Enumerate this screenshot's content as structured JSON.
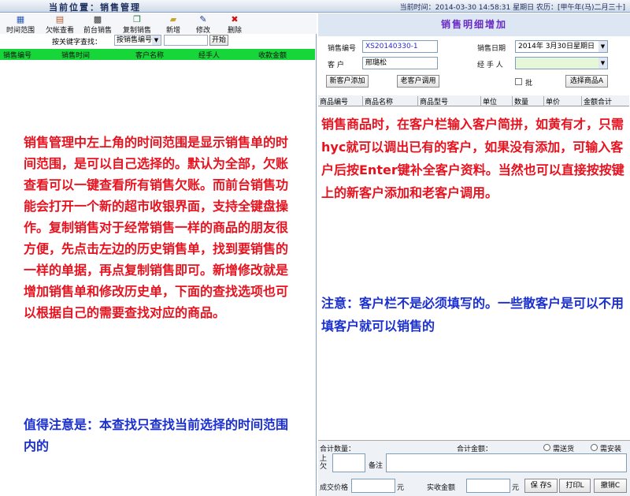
{
  "topbar": {
    "location": "当前位置：销售管理",
    "time": "当前时间：2014-03-30  14:58:31  星期日   农历：[甲午年(马)二月三十]"
  },
  "toolbar": {
    "items": [
      {
        "label": "时间范围",
        "icon": "calendar-icon"
      },
      {
        "label": "欠帐查看",
        "icon": "debt-icon"
      },
      {
        "label": "前台销售",
        "icon": "register-icon"
      },
      {
        "label": "复制销售",
        "icon": "copy-icon"
      },
      {
        "label": "新增",
        "icon": "folder-icon"
      },
      {
        "label": "修改",
        "icon": "edit-icon"
      },
      {
        "label": "删除",
        "icon": "delete-icon"
      }
    ]
  },
  "search": {
    "label": "按关键字查找：",
    "select_value": "按销售编号",
    "start_label": "开始"
  },
  "left_grid": {
    "columns": [
      "销售编号",
      "销售时间",
      "客户名称",
      "经手人",
      "收款金额"
    ]
  },
  "left_note": {
    "red": "销售管理中左上角的时间范围是显示销售单的时间范围，是可以自己选择的。默认为全部，欠账查看可以一键查看所有销售欠账。而前台销售功能会打开一个新的超市收银界面，支持全键盘操作。复制销售对于经常销售一样的商品的朋友很方便，先点击左边的历史销售单，找到要销售的一样的单据，再点复制销售即可。新增修改就是增加销售单和修改历史单，下面的查找选项也可以根据自己的需要查找对应的商品。",
    "blue": "值得注意是：本查找只查找当前选择的时间范围内的"
  },
  "right_panel": {
    "title": "销售明细增加",
    "sale_no_label": "销售编号",
    "sale_no": "XS20140330-1",
    "sale_date_label": "销售日期",
    "sale_date": "2014年 3月30日星期日",
    "customer_label": "客  户",
    "customer": "邢璐松",
    "handler_label": "经 手 人",
    "add_customer": "新客户添加",
    "old_customer": "老客户调用",
    "batch_label": "批",
    "choose_goods": "选择商品A",
    "columns": [
      "商品编号",
      "商品名称",
      "商品型号",
      "单位",
      "数量",
      "单价",
      "金额合计"
    ],
    "note_red": "销售商品时，在客户栏输入客户简拼，如黄有才，只需hyc就可以调出已有的客户，如果没有添加，可输入客户后按Enter键补全客户资料。当然也可以直接按按键上的新客户添加和老客户调用。",
    "note_blue": "注意：客户栏不是必须填写的。一些散客户是可以不用填客户就可以销售的",
    "footer": {
      "total_qty": "合计数量：",
      "total_amount": "合计金额：",
      "need_delivery": "需送货",
      "need_install": "需安装",
      "owe_label": "上欠",
      "remark_label": "备注",
      "deal_price": "成交价格",
      "yuan": "元",
      "received": "实收金额",
      "save": "保 存S",
      "print": "打印L",
      "cancel": "撤销C"
    }
  }
}
